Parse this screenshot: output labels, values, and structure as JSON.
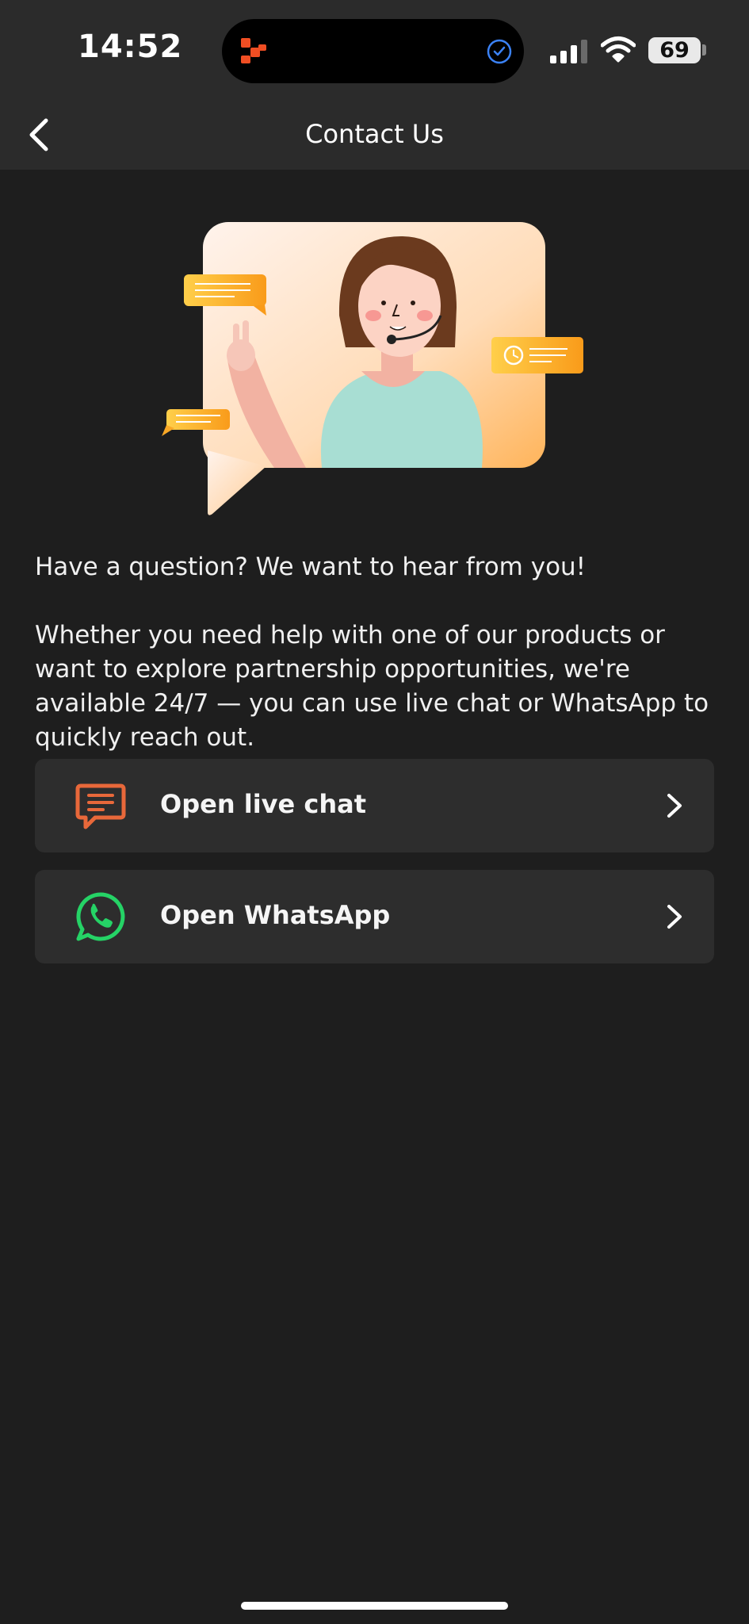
{
  "status_bar": {
    "time": "14:52",
    "battery_level": "69",
    "icons": [
      "app-logo-icon",
      "check-circle-icon",
      "signal-icon",
      "wifi-icon",
      "battery-icon"
    ]
  },
  "nav": {
    "title": "Contact Us",
    "back_icon": "chevron-left-icon"
  },
  "hero": {
    "illustration": "support-agent-illustration"
  },
  "intro": {
    "heading": "Have a question? We want to hear from you!",
    "body": "Whether you need help with one of our products or want to explore partnership opportunities, we're available 24/7 — you can use live chat or WhatsApp to quickly reach out."
  },
  "actions": [
    {
      "label": "Open live chat",
      "icon": "chat-bubble-icon",
      "icon_color": "#e8683a"
    },
    {
      "label": "Open WhatsApp",
      "icon": "whatsapp-icon",
      "icon_color": "#25d366"
    }
  ],
  "colors": {
    "background": "#1e1e1e",
    "bar": "#2b2b2b",
    "card": "#2d2d2d",
    "accent_orange": "#f6a623"
  }
}
